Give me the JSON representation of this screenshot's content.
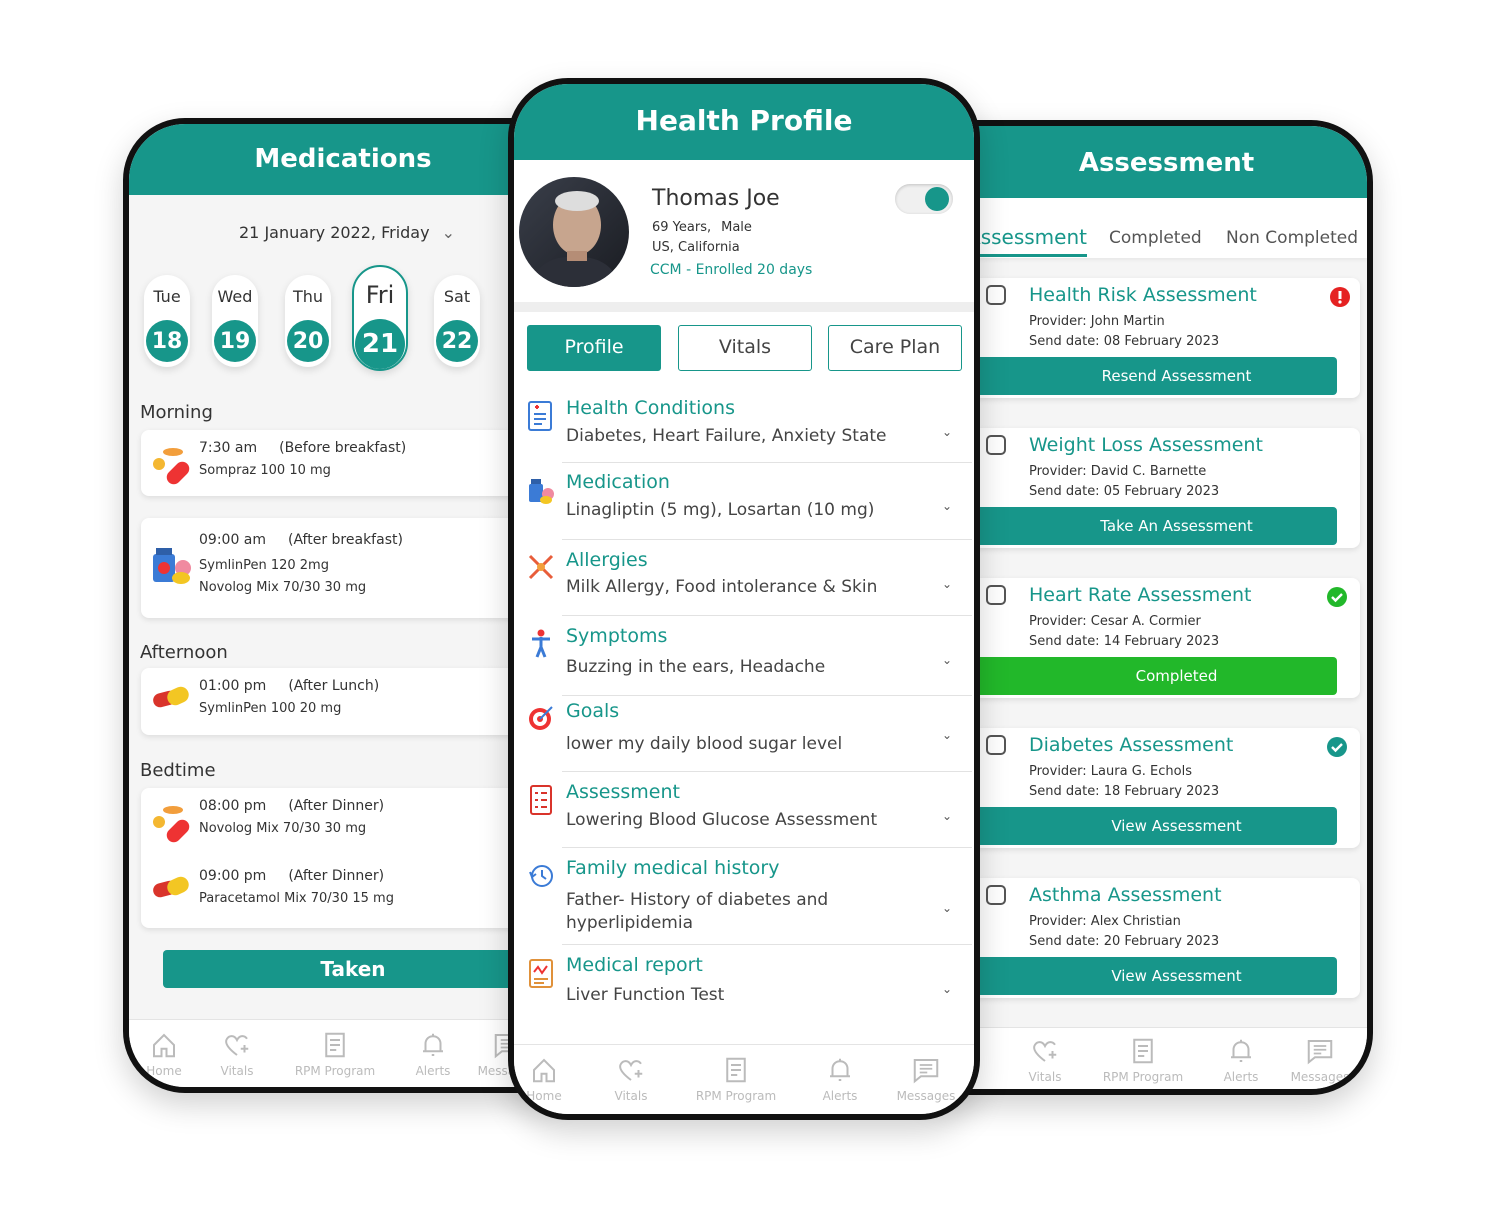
{
  "colors": {
    "accent": "#17968a",
    "completed": "#22b82a",
    "alert": "#e52222"
  },
  "medications": {
    "title": "Medications",
    "date": "21 January 2022, Friday",
    "days": [
      {
        "name": "Tue",
        "num": "18"
      },
      {
        "name": "Wed",
        "num": "19"
      },
      {
        "name": "Thu",
        "num": "20"
      },
      {
        "name": "Fri",
        "num": "21",
        "selected": true
      },
      {
        "name": "Sat",
        "num": "22"
      }
    ],
    "sections": [
      {
        "label": "Morning"
      },
      {
        "label": "Afternoon"
      },
      {
        "label": "Bedtime"
      }
    ],
    "cards": [
      {
        "entries": [
          {
            "time": "7:30 am",
            "when": "(Before breakfast)",
            "lines": [
              "Sompraz 100   10 mg"
            ],
            "icon": "pills-icon"
          }
        ]
      },
      {
        "entries": [
          {
            "time": "09:00 am",
            "when": "(After breakfast)",
            "lines": [
              "SymlinPen   120  2mg",
              "Novolog Mix 70/30  30 mg"
            ],
            "icon": "medicine-bottle-icon"
          }
        ]
      },
      {
        "entries": [
          {
            "time": "01:00 pm",
            "when": "(After Lunch)",
            "lines": [
              "SymlinPen 100   20 mg"
            ],
            "icon": "capsule-icon"
          }
        ]
      },
      {
        "entries": [
          {
            "time": "08:00 pm",
            "when": "(After Dinner)",
            "lines": [
              "Novolog Mix 70/30  30 mg"
            ],
            "icon": "pills-icon"
          },
          {
            "time": "09:00 pm",
            "when": "(After Dinner)",
            "lines": [
              "Paracetamol Mix 70/30  15 mg"
            ],
            "icon": "capsule-icon"
          }
        ]
      }
    ],
    "taken_label": "Taken"
  },
  "profile": {
    "title": "Health Profile",
    "name": "Thomas Joe",
    "age": "69 Years,",
    "gender": "Male",
    "location": "US, California",
    "enrollment": "CCM - Enrolled 20 days",
    "toggle_on": true,
    "tabs": [
      {
        "label": "Profile",
        "active": true
      },
      {
        "label": "Vitals"
      },
      {
        "label": "Care Plan"
      }
    ],
    "items": [
      {
        "title": "Health Conditions",
        "value": "Diabetes, Heart Failure, Anxiety State",
        "icon": "document-icon"
      },
      {
        "title": "Medication",
        "value": "Linagliptin (5 mg), Losartan (10 mg)",
        "icon": "medicine-icon"
      },
      {
        "title": "Allergies",
        "value": "Milk Allergy, Food intolerance & Skin",
        "icon": "allergy-icon"
      },
      {
        "title": "Symptoms",
        "value": "Buzzing in the ears, Headache",
        "icon": "body-icon"
      },
      {
        "title": "Goals",
        "value": "lower my daily blood sugar level",
        "icon": "target-icon"
      },
      {
        "title": "Assessment",
        "value": "Lowering Blood Glucose Assessment",
        "icon": "checklist-icon"
      },
      {
        "title": "Family medical history",
        "value": "Father- History of diabetes and hyperlipidemia",
        "icon": "history-icon"
      },
      {
        "title": "Medical report",
        "value": "Liver Function Test",
        "icon": "report-icon"
      }
    ]
  },
  "assessment": {
    "title": "Assessment",
    "tabs": [
      {
        "label": "Assessment",
        "active": true
      },
      {
        "label": "Completed"
      },
      {
        "label": "Non Completed"
      }
    ],
    "cards": [
      {
        "title": "Health Risk Assessment",
        "provider": "Provider: John Martin",
        "date": "Send date: 08 February 2023",
        "button": "Resend Assessment",
        "status": "alert"
      },
      {
        "title": "Weight Loss Assessment",
        "provider": "Provider: David C. Barnette",
        "date": "Send date: 05 February 2023",
        "button": "Take An Assessment",
        "status": "none"
      },
      {
        "title": "Heart Rate Assessment",
        "provider": "Provider: Cesar A. Cormier",
        "date": "Send date: 14 February 2023",
        "button": "Completed",
        "status": "completed"
      },
      {
        "title": "Diabetes Assessment",
        "provider": "Provider: Laura G. Echols",
        "date": "Send date: 18 February 2023",
        "button": "View Assessment",
        "status": "checked"
      },
      {
        "title": "Asthma Assessment",
        "provider": "Provider: Alex Christian",
        "date": "Send date: 20 February 2023",
        "button": "View Assessment",
        "status": "none"
      }
    ]
  },
  "nav": [
    {
      "label": "Home",
      "icon": "home-icon"
    },
    {
      "label": "Vitals",
      "icon": "heart-plus-icon"
    },
    {
      "label": "RPM Program",
      "icon": "document-list-icon"
    },
    {
      "label": "Alerts",
      "icon": "bell-icon"
    },
    {
      "label": "Messages",
      "icon": "message-icon"
    }
  ]
}
